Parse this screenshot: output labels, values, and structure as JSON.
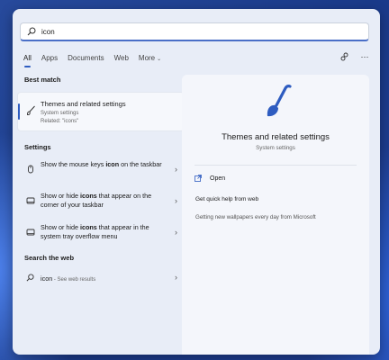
{
  "search": {
    "value": "icon"
  },
  "tabs": [
    {
      "label": "All"
    },
    {
      "label": "Apps"
    },
    {
      "label": "Documents"
    },
    {
      "label": "Web"
    },
    {
      "label": "More"
    }
  ],
  "best_match": {
    "section_title": "Best match",
    "title": "Themes and related settings",
    "subtitle": "System settings",
    "related": "Related: \"icons\""
  },
  "settings": {
    "section_title": "Settings",
    "items": [
      {
        "before": "Show the mouse keys ",
        "highlight": "icon",
        "after": " on the taskbar"
      },
      {
        "before": "Show or hide ",
        "highlight": "icons",
        "after": " that appear on the corner of your taskbar"
      },
      {
        "before": "Show or hide ",
        "highlight": "icons",
        "after": " that appear in the system tray overflow menu"
      }
    ]
  },
  "web": {
    "section_title": "Search the web",
    "query": "icon",
    "suffix": " - See web results"
  },
  "preview": {
    "title": "Themes and related settings",
    "subtitle": "System settings",
    "open_label": "Open",
    "help_label": "Get quick help from web",
    "wallpaper_label": "Getting new wallpapers every day from Microsoft"
  },
  "colors": {
    "accent": "#2e5cc0",
    "panel": "#e8edf7"
  }
}
